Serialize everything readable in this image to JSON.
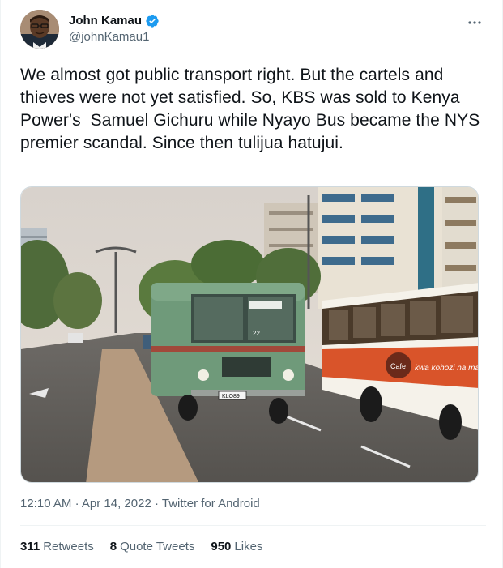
{
  "user": {
    "display_name": "John Kamau",
    "handle": "@johnKamau1",
    "verified": true
  },
  "tweet": {
    "text": "We almost got public transport right. But the cartels and thieves were not yet satisfied. So, KBS was sold to Kenya Power's  Samuel Gichuru while Nyayo Bus became the NYS premier scandal. Since then tulijua hatujui.",
    "time": "12:10 AM",
    "sep1": "·",
    "date": "Apr 14, 2022",
    "sep2": "·",
    "source": "Twitter for Android"
  },
  "image": {
    "bus_route_sign": "22",
    "bus_plate": "KLO89",
    "ad_brand": "Cafe",
    "ad_slogan": "kwa kohozi na mafua"
  },
  "stats": {
    "retweets_count": "311",
    "retweets_label": "Retweets",
    "quotes_count": "8",
    "quotes_label": "Quote Tweets",
    "likes_count": "950",
    "likes_label": "Likes"
  },
  "colors": {
    "verified_blue": "#1d9bf0",
    "text_primary": "#0f1419",
    "text_secondary": "#536471",
    "divider": "#eff3f4"
  },
  "icons": {
    "verified": "verified-badge-icon",
    "more": "more-options-icon"
  }
}
